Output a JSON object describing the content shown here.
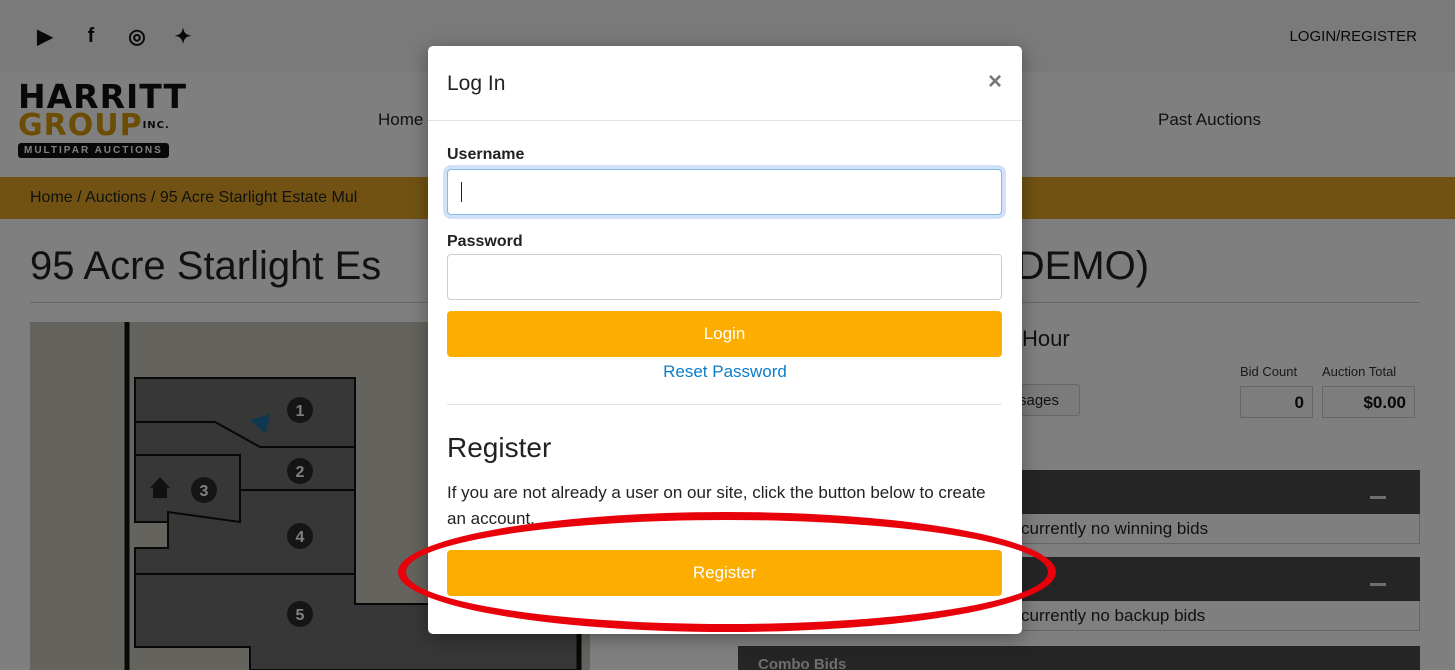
{
  "topbar": {
    "social_icons": [
      "youtube-icon",
      "facebook-icon",
      "instagram-icon",
      "twitter-icon"
    ],
    "login_register": "LOGIN/REGISTER"
  },
  "logo": {
    "line1": "HARRITT",
    "line2": "GROUP",
    "inc": "INC.",
    "line3": "MULTIPAR AUCTIONS"
  },
  "nav": {
    "home": "Home",
    "past_auctions": "Past Auctions"
  },
  "breadcrumb": "Home / Auctions / 95 Acre Starlight Estate Mul",
  "page": {
    "title_left": "95 Acre Starlight Es",
    "title_right": "(DEMO)",
    "hour": "Hour",
    "messages_btn": "sages",
    "bid_count_label": "Bid Count",
    "bid_count": "0",
    "auction_total_label": "Auction Total",
    "auction_total": "$0.00",
    "winning_text": "currently no winning bids",
    "backup_text": "currently no backup bids",
    "combo_bids": "Combo Bids",
    "map_lots": [
      "1",
      "2",
      "3",
      "4",
      "5"
    ]
  },
  "modal": {
    "title": "Log In",
    "close": "×",
    "username_label": "Username",
    "username_value": "",
    "password_label": "Password",
    "password_value": "",
    "login_button": "Login",
    "reset_password": "Reset Password",
    "register_title": "Register",
    "register_text": "If you are not already a user on our site, click the button below to create an account.",
    "register_button": "Register"
  },
  "colors": {
    "accent": "#fdac00",
    "breadcrumb_bar": "#e3a524",
    "link": "#0b7dc8",
    "highlight": "#e8000a"
  }
}
